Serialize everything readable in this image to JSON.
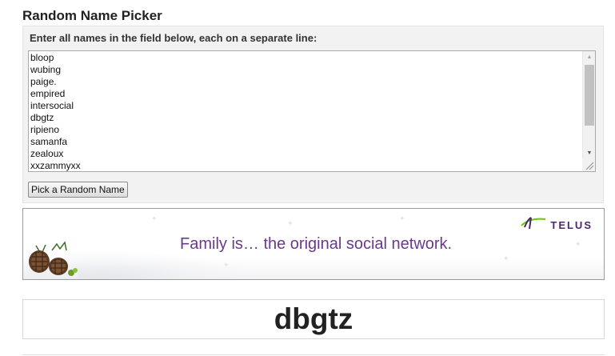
{
  "page": {
    "title": "Random Name Picker"
  },
  "form": {
    "instructions": "Enter all names in the field below, each on a separate line:",
    "names": [
      "bloop",
      "wubing",
      "paige.",
      "empired",
      "intersocial",
      "dbgtz",
      "ripieno",
      "samanfa",
      "zealoux",
      "xxzammyxx"
    ],
    "pick_button_label": "Pick a Random Name"
  },
  "ad": {
    "tagline": "Family is… the original social network.",
    "brand": "TELUS",
    "brand_color": "#4b286d",
    "accent_color": "#66cc00",
    "tagline_color": "#6a3a8a"
  },
  "result": {
    "picked_name": "dbgtz"
  },
  "icons": {
    "scroll_up": "scroll-up-arrow-icon",
    "scroll_down": "scroll-down-arrow-icon",
    "resize": "resize-grip-icon",
    "brand_logo": "telus-logo-icon",
    "decoration": "pinecones-icon"
  }
}
